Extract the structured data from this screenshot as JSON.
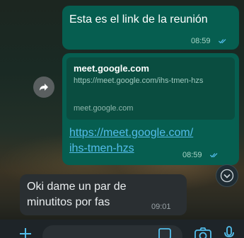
{
  "messages": [
    {
      "direction": "outgoing",
      "text": "Esta es el link de la reunión",
      "time": "08:59"
    },
    {
      "direction": "outgoing",
      "preview": {
        "title": "meet.google.com",
        "url": "https://meet.google.com/ihs-tmen-hzs",
        "domain": "meet.google.com"
      },
      "link_line1": "https://meet.google.com/",
      "link_line2": "ihs-tmen-hzs",
      "time": "08:59"
    },
    {
      "direction": "incoming",
      "line1": "Oki dame un par de",
      "line2": "minutitos por fas",
      "time": "09:01"
    }
  ],
  "composer": {
    "placeholder": ""
  },
  "colors": {
    "outgoing_bubble": "#065e50",
    "incoming_bubble": "#2a2f32",
    "link": "#53bdeb",
    "read_ticks": "#53bdeb",
    "accent": "#00a884"
  }
}
